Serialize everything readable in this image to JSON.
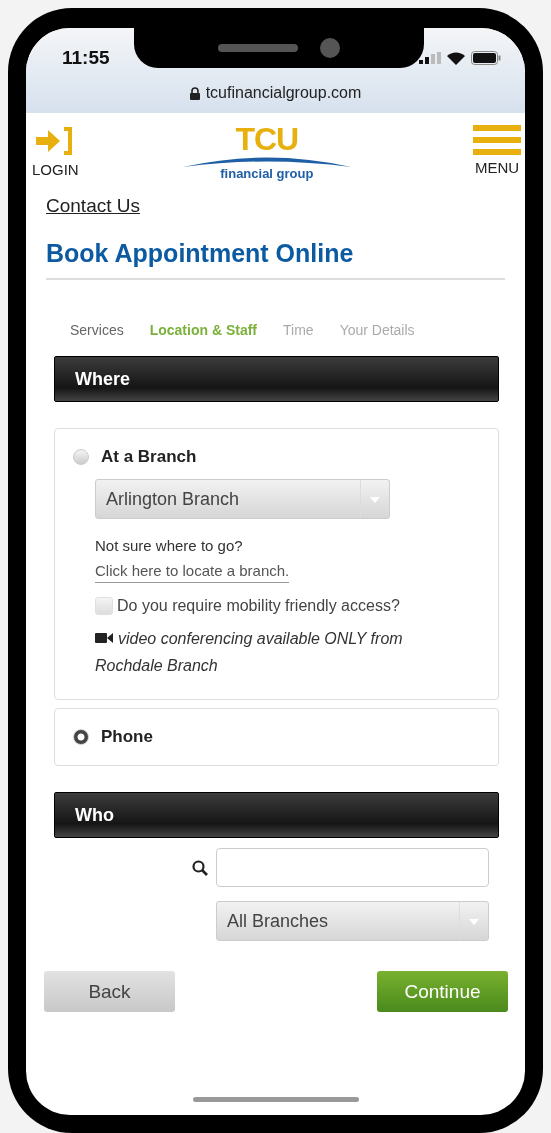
{
  "status_bar": {
    "time": "11:55",
    "url": "tcufinancialgroup.com"
  },
  "header": {
    "login_label": "LOGIN",
    "logo": {
      "wordmark": "TCU",
      "tagline": "financial group"
    },
    "menu_label": "MENU"
  },
  "contact_link": "Contact Us",
  "title": "Book Appointment Online",
  "steps": [
    {
      "label": "Services",
      "selected": false,
      "completed": true
    },
    {
      "label": "Location & Staff",
      "selected": true,
      "completed": false
    },
    {
      "label": "Time",
      "selected": false,
      "completed": false
    },
    {
      "label": "Your Details",
      "selected": false,
      "completed": false
    }
  ],
  "where": {
    "heading": "Where",
    "options": [
      {
        "kind": "branch",
        "label": "At a Branch",
        "selected": false,
        "select_value": "Arlington Branch",
        "hint": "Not sure where to go?",
        "link": "Click here to locate a branch.",
        "checkbox": {
          "label": "Do you require mobility friendly access?",
          "checked": false
        },
        "note": "video conferencing available ONLY from Rochdale Branch"
      },
      {
        "kind": "phone",
        "label": "Phone",
        "selected": true
      }
    ]
  },
  "who": {
    "heading": "Who",
    "select_value": "All Branches"
  },
  "buttons": [
    {
      "label": "Back",
      "kind": "secondary"
    },
    {
      "label": "Continue",
      "kind": "primary"
    }
  ]
}
